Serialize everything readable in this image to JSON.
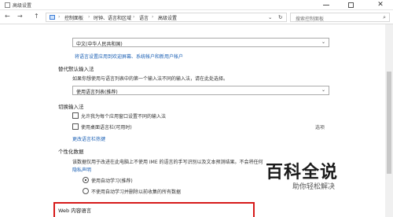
{
  "window": {
    "title": "高级设置"
  },
  "titlebar": {
    "minimize_icon": "minimize-icon",
    "maximize_icon": "maximize-icon",
    "close_icon": "close-icon",
    "close_glyph": "✕"
  },
  "addressbar": {
    "back_glyph": "←",
    "forward_glyph": "→",
    "up_glyph": "↑",
    "breadcrumbs": [
      "控制面板",
      "时钟、语言和区域",
      "语言",
      "高级设置"
    ],
    "separator": "›",
    "refresh_glyph": "↻",
    "search_placeholder": "搜索控制面板",
    "search_glyph": "⌕"
  },
  "override_display_language": {
    "dropdown_value": "中文(中华人民共和国)",
    "link": "将语言设置应用到欢迎屏幕、系统帐户和新用户帐户"
  },
  "override_input_method": {
    "title": "替代默认输入法",
    "description": "如果你想使用与语言列表中的第一个输入法不同的输入法，请在此处选择。",
    "dropdown_value": "使用语言列表(推荐)"
  },
  "switching_input_methods": {
    "title": "切换输入法",
    "checkbox1_label": "允许我为每个应用窗口设置不同的输入法",
    "checkbox2_label": "使用桌面语言栏(可用时)",
    "options_link": "选项",
    "hotkeys_link": "更改语言栏热键"
  },
  "personalization_data": {
    "title": "个性化数据",
    "description": "该数据仅用于改进在此电脑上不使用 IME 的语言的手写识别以及文本预测结果。不会将任何",
    "privacy_link": "隐私声明",
    "radio1_label": "使用自动学习(推荐)",
    "radio2_label": "不使用自动学习并删除以前收集的所有数据"
  },
  "web_content_language": {
    "title": "Web 内容语言"
  },
  "watermark": {
    "big": "百科全说",
    "small": "助你轻松解决"
  },
  "dropdown_chevron": "⌄"
}
